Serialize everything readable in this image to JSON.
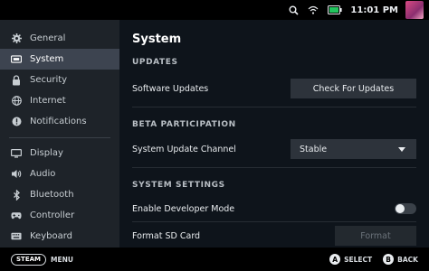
{
  "statusbar": {
    "clock": "11:01 PM",
    "icons": [
      "search-icon",
      "wifi-icon",
      "battery-icon"
    ],
    "battery_color": "#22c55e"
  },
  "sidebar": {
    "items": [
      {
        "label": "General",
        "icon": "gear-icon"
      },
      {
        "label": "System",
        "icon": "system-icon",
        "active": true
      },
      {
        "label": "Security",
        "icon": "lock-icon"
      },
      {
        "label": "Internet",
        "icon": "globe-icon"
      },
      {
        "label": "Notifications",
        "icon": "alert-icon"
      },
      {
        "label": "Display",
        "icon": "display-icon"
      },
      {
        "label": "Audio",
        "icon": "speaker-icon"
      },
      {
        "label": "Bluetooth",
        "icon": "bluetooth-icon"
      },
      {
        "label": "Controller",
        "icon": "controller-icon"
      },
      {
        "label": "Keyboard",
        "icon": "keyboard-icon"
      }
    ]
  },
  "main": {
    "title": "System",
    "updates": {
      "header": "UPDATES",
      "label": "Software Updates",
      "button": "Check For Updates"
    },
    "beta": {
      "header": "BETA PARTICIPATION",
      "label": "System Update Channel",
      "value": "Stable"
    },
    "settings": {
      "header": "SYSTEM SETTINGS",
      "dev_mode_label": "Enable Developer Mode",
      "dev_mode_on": false,
      "format_label": "Format SD Card",
      "format_button": "Format"
    }
  },
  "bottombar": {
    "steam": "STEAM",
    "menu": "MENU",
    "a_glyph": "A",
    "select": "SELECT",
    "b_glyph": "B",
    "back": "BACK"
  }
}
